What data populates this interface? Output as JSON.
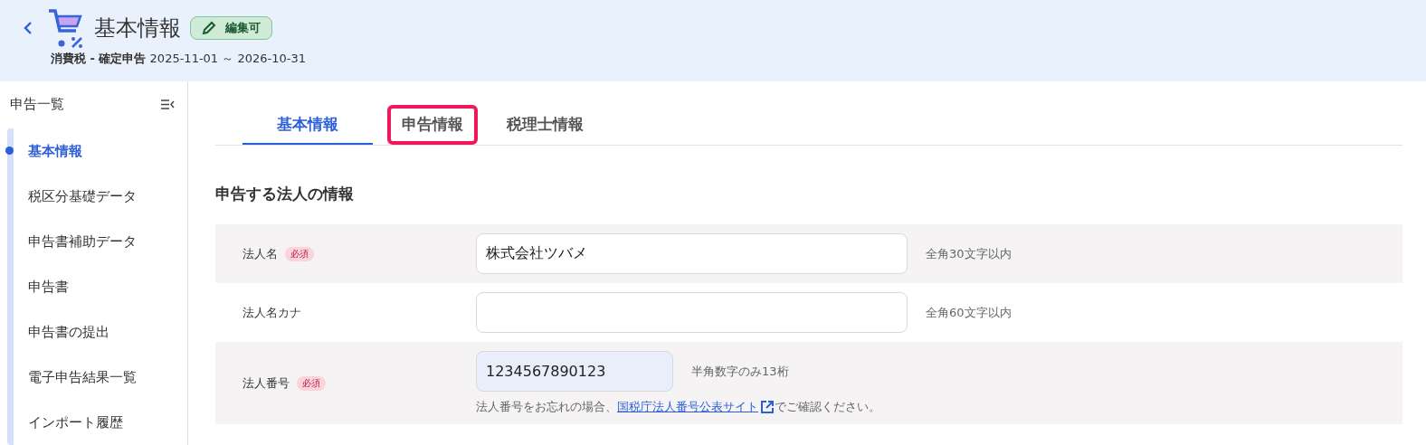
{
  "header": {
    "title": "基本情報",
    "badge": "編集可",
    "subtitle": "**消費税 - 確定申告** 2025-11-01 ～ 2026-10-31"
  },
  "sidebar": {
    "title": "申告一覧",
    "items": [
      {
        "label": "基本情報",
        "selected": true
      },
      {
        "label": "税区分基礎データ",
        "selected": false
      },
      {
        "label": "申告書補助データ",
        "selected": false
      },
      {
        "label": "申告書",
        "selected": false
      },
      {
        "label": "申告書の提出",
        "selected": false
      },
      {
        "label": "電子申告結果一覧",
        "selected": false
      },
      {
        "label": "インポート履歴",
        "selected": false
      }
    ]
  },
  "tabs": [
    {
      "label": "基本情報",
      "selected": true,
      "highlighted": false
    },
    {
      "label": "申告情報",
      "selected": false,
      "highlighted": true
    },
    {
      "label": "税理士情報",
      "selected": false,
      "highlighted": false
    }
  ],
  "section_title": "申告する法人の情報",
  "fields": [
    {
      "label": "法人名",
      "required": true,
      "required_label": "必須",
      "value": "株式会社ツバメ",
      "hint": "全角30文字以内",
      "wide": true,
      "filled": false
    },
    {
      "label": "法人名カナ",
      "required": false,
      "hint": "全角60文字以内",
      "wide": true,
      "filled": false
    },
    {
      "label": "法人番号",
      "required": true,
      "required_label": "必須",
      "value": "1234567890123",
      "hint": "半角数字のみ13桁",
      "wide": false,
      "filled": true,
      "note_before": "法人番号をお忘れの場合、",
      "note_link": "国税庁法人番号公表サイト",
      "note_after": "でご確認ください。"
    }
  ]
}
